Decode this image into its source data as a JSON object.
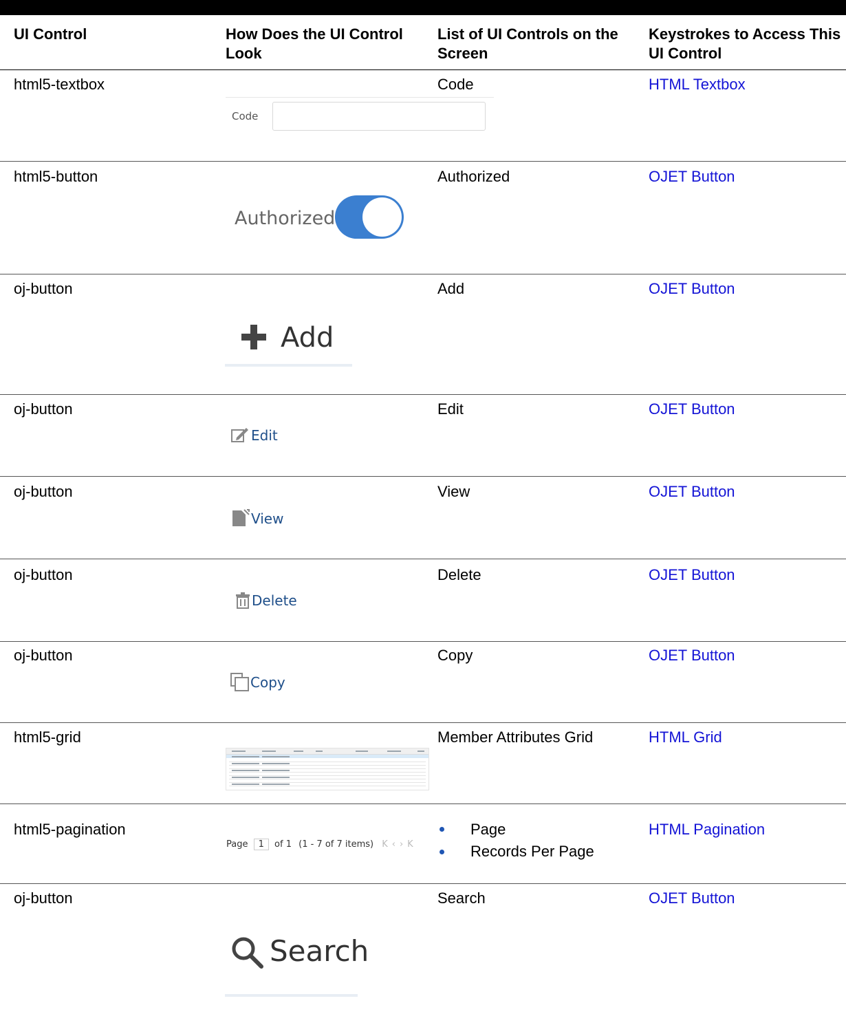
{
  "headers": {
    "col1": "UI Control",
    "col2": "How Does the UI Control Look",
    "col3": "List of UI Controls on the Screen",
    "col4": "Keystrokes to Access This UI Control"
  },
  "rows": [
    {
      "control": "html5-textbox",
      "list": "Code",
      "keystroke": "HTML Textbox"
    },
    {
      "control": "html5-button",
      "list": "Authorized",
      "keystroke": "OJET Button"
    },
    {
      "control": "oj-button",
      "list": "Add",
      "keystroke": "OJET Button"
    },
    {
      "control": "oj-button",
      "list": "Edit",
      "keystroke": "OJET Button"
    },
    {
      "control": "oj-button",
      "list": "View",
      "keystroke": "OJET Button"
    },
    {
      "control": "oj-button",
      "list": "Delete",
      "keystroke": "OJET Button"
    },
    {
      "control": "oj-button",
      "list": "Copy",
      "keystroke": "OJET Button"
    },
    {
      "control": "html5-grid",
      "list": "Member Attributes Grid",
      "keystroke": "HTML Grid"
    },
    {
      "control": "html5-pagination",
      "list_items": [
        "Page",
        "Records Per Page"
      ],
      "keystroke": "HTML Pagination"
    },
    {
      "control": "oj-button",
      "list": "Search",
      "keystroke": "OJET Button"
    }
  ],
  "previews": {
    "textbox_label": "Code",
    "toggle_label": "Authorized",
    "toggle_on": true,
    "add_label": "Add",
    "edit_label": "Edit",
    "view_label": "View",
    "delete_label": "Delete",
    "copy_label": "Copy",
    "pagination": {
      "page_word": "Page",
      "page_value": "1",
      "of_text": "of 1",
      "items_text": "(1 - 7 of 7  items)"
    },
    "search_label": "Search"
  },
  "colors": {
    "link": "#1414d6",
    "toggle_on": "#3b7fd0",
    "button_text": "#1f4f8a"
  },
  "icons": [
    "plus-icon",
    "edit-icon",
    "view-icon",
    "delete-icon",
    "copy-icon",
    "search-icon",
    "first-page-icon",
    "prev-page-icon",
    "next-page-icon",
    "last-page-icon"
  ]
}
